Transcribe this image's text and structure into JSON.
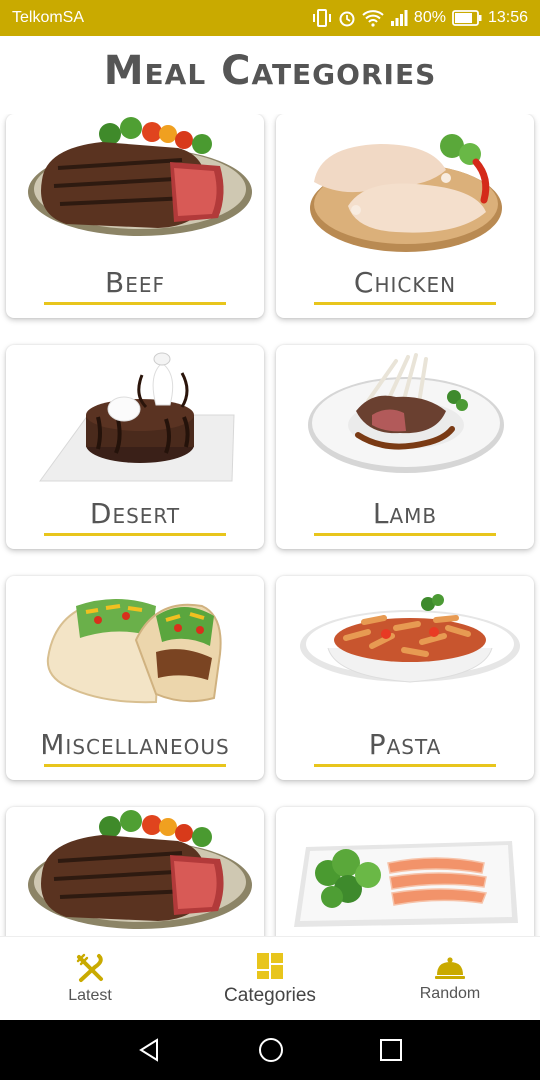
{
  "status_bar": {
    "carrier": "TelkomSA",
    "battery": "80%",
    "time": "13:56"
  },
  "header": {
    "title": "Meal Categories"
  },
  "categories": [
    {
      "label": "Beef",
      "image": "steak-plate"
    },
    {
      "label": "Chicken",
      "image": "raw-chicken-board"
    },
    {
      "label": "Desert",
      "image": "chocolate-cake"
    },
    {
      "label": "Lamb",
      "image": "lamb-rack-plate"
    },
    {
      "label": "Miscellaneous",
      "image": "tacos"
    },
    {
      "label": "Pasta",
      "image": "penne-bowl"
    },
    {
      "label": "",
      "image": "steak-plate"
    },
    {
      "label": "",
      "image": "salmon-salad-plate"
    }
  ],
  "bottom_nav": {
    "items": [
      {
        "label": "Latest",
        "icon": "utensils-icon"
      },
      {
        "label": "Categories",
        "icon": "grid-icon"
      },
      {
        "label": "Random",
        "icon": "cloche-icon"
      }
    ],
    "active": "Categories"
  },
  "colors": {
    "accent": "#c9aa00",
    "underline": "#e8c51c",
    "text": "#555555"
  }
}
